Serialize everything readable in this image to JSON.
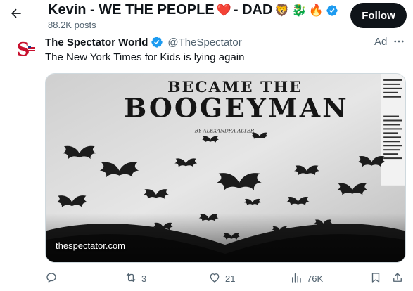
{
  "header": {
    "profile_name": "Kevin - WE THE PEOPLE",
    "name_suffix_dad": " - DAD",
    "name_emojis": [
      "❤️",
      "🦁",
      "🐉",
      "🔥"
    ],
    "post_count": "88.2K posts",
    "follow_label": "Follow"
  },
  "tweet": {
    "author_name": "The Spectator World",
    "author_handle": "@TheSpectator",
    "ad_label": "Ad",
    "text": "The New York Times for Kids is lying again",
    "media": {
      "headline_top": "BECAME THE",
      "headline_main": "BOOGEYMAN",
      "byline": "BY ALEXANDRA ALTER",
      "domain": "thespectator.com"
    },
    "actions": {
      "replies": "",
      "reposts": "3",
      "likes": "21",
      "views": "76K"
    }
  },
  "colors": {
    "text_primary": "#0f1419",
    "text_secondary": "#536471",
    "verified_blue": "#1d9bf0",
    "brand_red": "#c8102e",
    "heart_red": "#e0245e",
    "follow_bg": "#0f1419"
  },
  "icons": {
    "back": "arrow-left-icon",
    "verified": "verified-badge-icon",
    "more": "more-horizontal-icon",
    "reply": "reply-icon",
    "repost": "repost-icon",
    "like": "heart-icon",
    "views": "views-bar-chart-icon",
    "bookmark": "bookmark-icon",
    "share": "share-icon"
  }
}
